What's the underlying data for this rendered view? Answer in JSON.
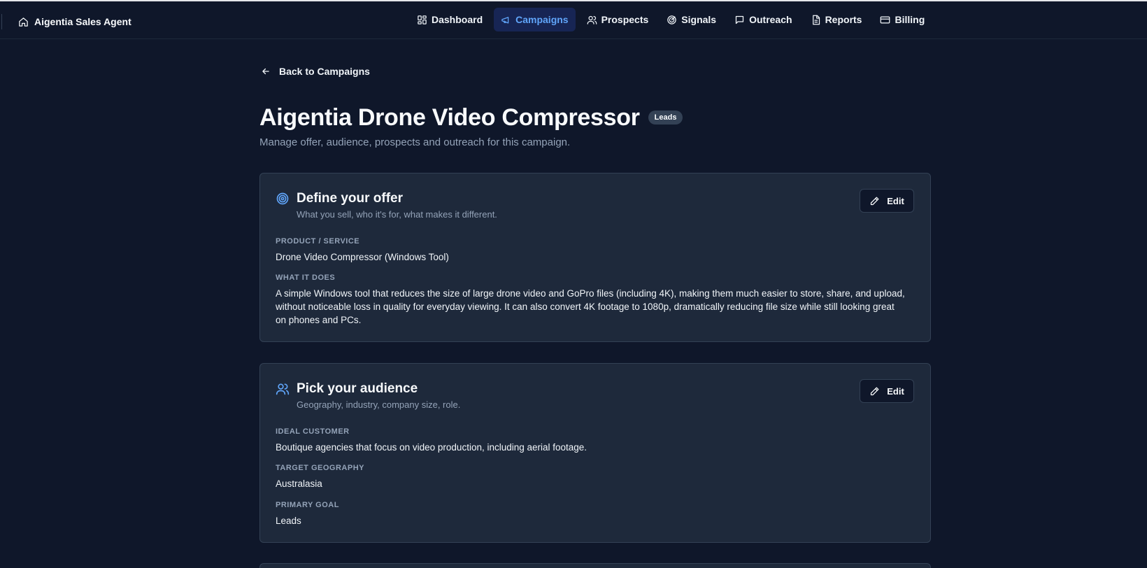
{
  "brand": {
    "name": "Aigentia Sales Agent",
    "icon": "home-icon"
  },
  "nav": {
    "items": [
      {
        "label": "Dashboard",
        "icon": "grid-icon",
        "active": false
      },
      {
        "label": "Campaigns",
        "icon": "megaphone-icon",
        "active": true
      },
      {
        "label": "Prospects",
        "icon": "users-icon",
        "active": false
      },
      {
        "label": "Signals",
        "icon": "radar-icon",
        "active": false
      },
      {
        "label": "Outreach",
        "icon": "message-icon",
        "active": false
      },
      {
        "label": "Reports",
        "icon": "file-icon",
        "active": false
      },
      {
        "label": "Billing",
        "icon": "card-icon",
        "active": false
      }
    ]
  },
  "back_link": {
    "label": "Back to Campaigns",
    "icon": "arrow-left-icon"
  },
  "page": {
    "title": "Aigentia Drone Video Compressor",
    "badge": "Leads",
    "subtitle": "Manage offer, audience, prospects and outreach for this campaign."
  },
  "offer_card": {
    "icon": "target-icon",
    "title": "Define your offer",
    "subtitle": "What you sell, who it's for, what makes it different.",
    "edit_label": "Edit",
    "fields": [
      {
        "label": "PRODUCT / SERVICE",
        "value": "Drone Video Compressor (Windows Tool)"
      },
      {
        "label": "WHAT IT DOES",
        "value": "A simple Windows tool that reduces the size of large drone video and GoPro files (including 4K), making them much easier to store, share, and upload, without noticeable loss in quality for everyday viewing. It can also convert 4K footage to 1080p, dramatically reducing file size while still looking great on phones and PCs."
      }
    ]
  },
  "audience_card": {
    "icon": "users-icon",
    "title": "Pick your audience",
    "subtitle": "Geography, industry, company size, role.",
    "edit_label": "Edit",
    "fields": [
      {
        "label": "IDEAL CUSTOMER",
        "value": "Boutique agencies that focus on video production, including aerial footage."
      },
      {
        "label": "TARGET GEOGRAPHY",
        "value": "Australasia"
      },
      {
        "label": "PRIMARY GOAL",
        "value": "Leads"
      }
    ]
  },
  "colors": {
    "background": "#0f172a",
    "card": "#1e293b",
    "accent": "#60a5fa",
    "muted_text": "#94a3b8"
  }
}
